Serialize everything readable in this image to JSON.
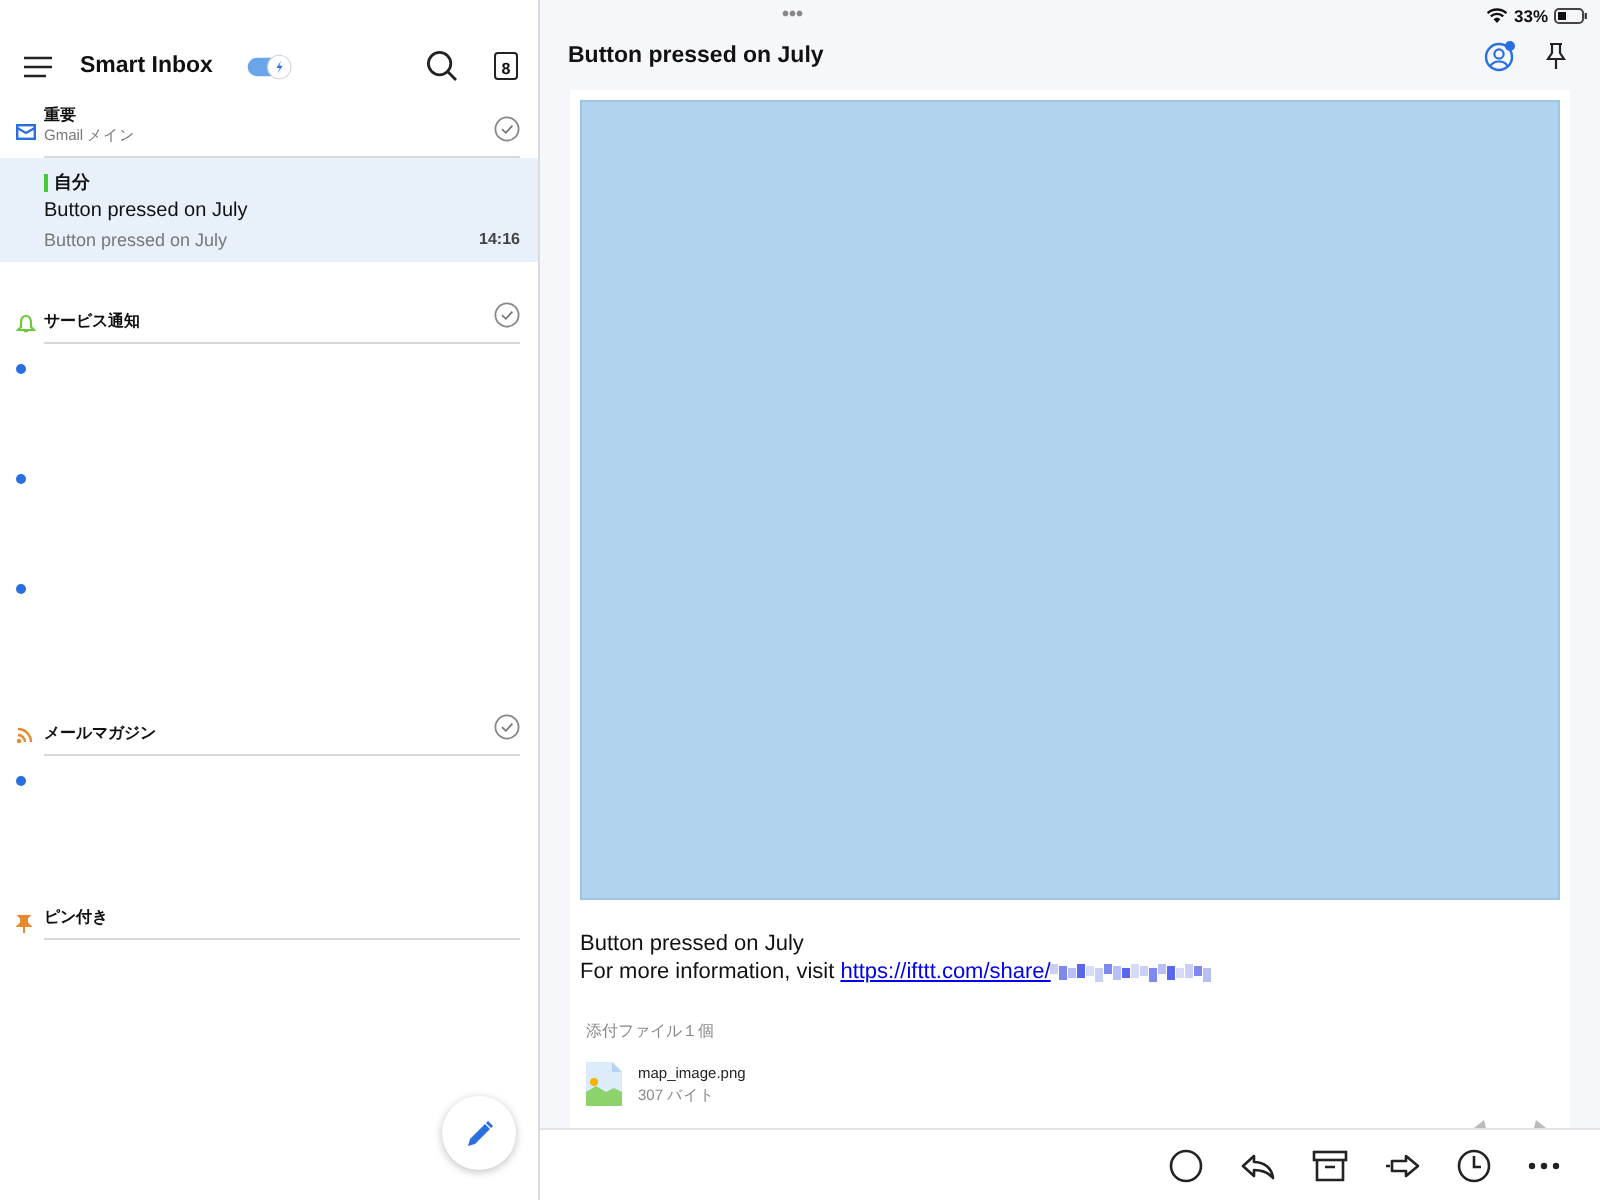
{
  "status_bar": {
    "dots": "•••",
    "battery": "33%"
  },
  "mail_list": {
    "title": "Smart Inbox",
    "smart_toggle": {
      "on": true
    },
    "calendar_day": "8",
    "sections": [
      {
        "kind": "important",
        "title": "重要",
        "subtitle": "Gmail メイン",
        "done": true,
        "items": [
          {
            "kind": "message",
            "selected": true,
            "color": "#46c93a",
            "sender": "自分",
            "subject": "Button pressed on July",
            "preview": "Button pressed on July",
            "time": "14:16"
          }
        ]
      },
      {
        "kind": "notifications",
        "title": "サービス通知",
        "done": true,
        "items": [
          {
            "kind": "blank",
            "unread": true
          },
          {
            "kind": "blank",
            "unread": true
          },
          {
            "kind": "blank",
            "unread": true
          }
        ]
      },
      {
        "kind": "newsletters",
        "title": "メールマガジン",
        "done": true,
        "items": [
          {
            "kind": "blank",
            "unread": true
          }
        ]
      },
      {
        "kind": "pinned",
        "title": "ピン付き",
        "done": false
      }
    ]
  },
  "message": {
    "title": "Button pressed on July",
    "account_badge": true,
    "body": {
      "line": "Button pressed on July",
      "prefix": "For more information, visit",
      "link": "https://ifttt.com/share/"
    },
    "attachments": {
      "heading": "添付ファイル１個",
      "files": [
        {
          "name": "map_image.png",
          "size": "307 バイト"
        }
      ]
    }
  }
}
